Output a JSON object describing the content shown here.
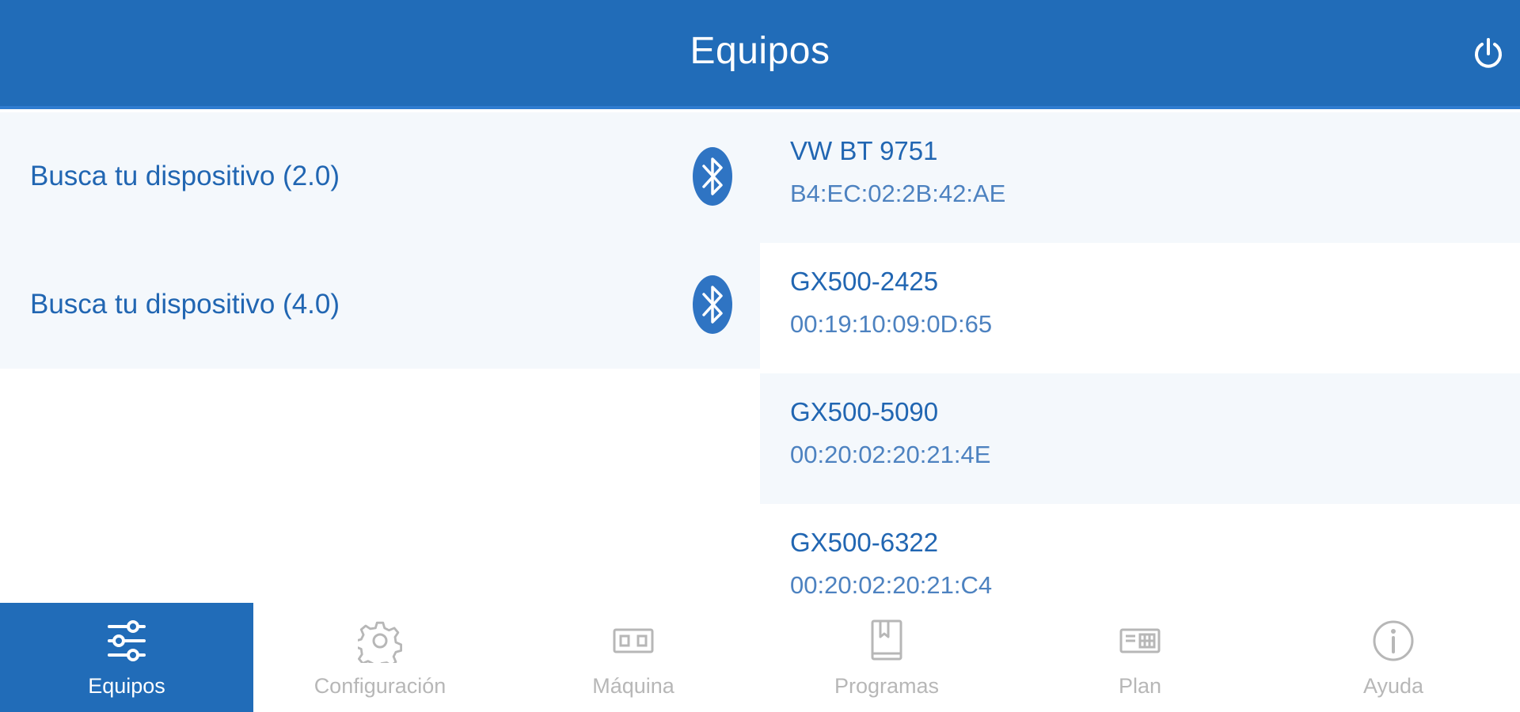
{
  "header": {
    "title": "Equipos"
  },
  "scan": [
    {
      "label": "Busca tu dispositivo (2.0)"
    },
    {
      "label": "Busca tu dispositivo (4.0)"
    }
  ],
  "devices": [
    {
      "name": "VW BT 9751",
      "mac": "B4:EC:02:2B:42:AE"
    },
    {
      "name": "GX500-2425",
      "mac": "00:19:10:09:0D:65"
    },
    {
      "name": "GX500-5090",
      "mac": "00:20:02:20:21:4E"
    },
    {
      "name": "GX500-6322",
      "mac": "00:20:02:20:21:C4"
    }
  ],
  "tabs": [
    {
      "label": "Equipos",
      "icon": "sliders-icon",
      "active": true
    },
    {
      "label": "Configuración",
      "icon": "gear-icon",
      "active": false
    },
    {
      "label": "Máquina",
      "icon": "machine-icon",
      "active": false
    },
    {
      "label": "Programas",
      "icon": "book-icon",
      "active": false
    },
    {
      "label": "Plan",
      "icon": "plan-icon",
      "active": false
    },
    {
      "label": "Ayuda",
      "icon": "info-icon",
      "active": false
    }
  ],
  "colors": {
    "primary": "#216cb8",
    "text_blue": "#2166b2",
    "row_tint": "#f4f8fc",
    "tab_inactive": "#b7b7b7"
  }
}
